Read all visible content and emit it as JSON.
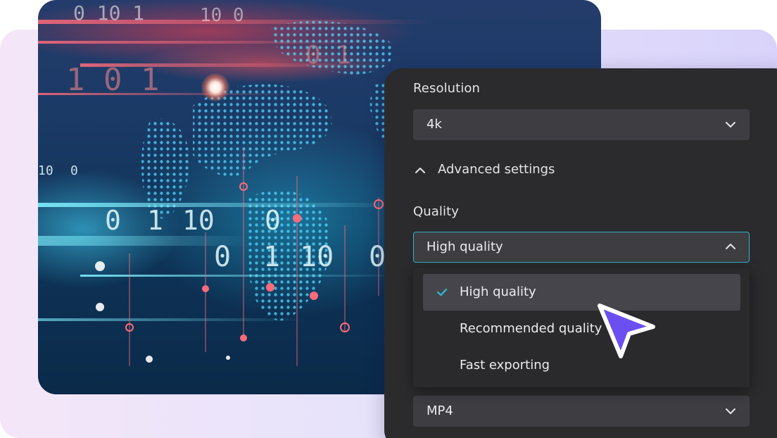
{
  "colors": {
    "panel_bg": "#2b2b2e",
    "field_bg": "#3d3d42",
    "focus_border": "#2fb4c9",
    "check_color": "#2fb4c9",
    "cursor_fill": "#6b4ff0"
  },
  "settings": {
    "resolution": {
      "label": "Resolution",
      "value": "4k",
      "icon": "chevron-down-icon"
    },
    "advanced": {
      "label": "Advanced settings",
      "icon": "chevron-up-icon",
      "expanded": true
    },
    "quality": {
      "label": "Quality",
      "value": "High quality",
      "icon": "chevron-up-icon",
      "open": true,
      "options": [
        {
          "label": "High quality",
          "selected": true,
          "icon": "check-icon"
        },
        {
          "label": "Recommended quality",
          "selected": false
        },
        {
          "label": "Fast exporting",
          "selected": false
        }
      ]
    },
    "format": {
      "value": "MP4",
      "icon": "chevron-down-icon"
    }
  },
  "hero_image": {
    "alt_icon": "digital-world-map-image",
    "digits": [
      "0",
      "1",
      "10",
      "0",
      "1",
      "0",
      "10",
      "0",
      "1",
      "10",
      "0",
      "1",
      "0",
      "10",
      "1",
      "0"
    ]
  },
  "pointer": {
    "icon": "mouse-pointer-icon"
  }
}
